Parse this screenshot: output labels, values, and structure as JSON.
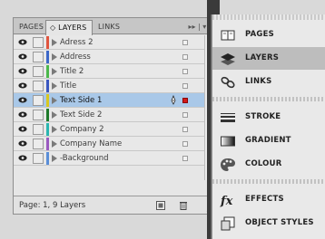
{
  "layers_panel": {
    "tabs": [
      {
        "label": "PAGES"
      },
      {
        "label": "◇ LAYERS"
      },
      {
        "label": "LINKS"
      }
    ],
    "controls_label": "▸▸ | ▾≡",
    "layers": [
      {
        "name": "Adress 2",
        "color": "#e0553f",
        "selected": false
      },
      {
        "name": "Address",
        "color": "#3c67c8",
        "selected": false
      },
      {
        "name": "Title 2",
        "color": "#4bb84b",
        "selected": false
      },
      {
        "name": "Title",
        "color": "#3a57c0",
        "selected": false
      },
      {
        "name": "Text Side 1",
        "color": "#d8c820",
        "selected": true
      },
      {
        "name": "Text Side 2",
        "color": "#1f7a2b",
        "selected": false
      },
      {
        "name": "Company 2",
        "color": "#2bb6b0",
        "selected": false
      },
      {
        "name": "Company Name",
        "color": "#9a5ac0",
        "selected": false
      },
      {
        "name": "-Background",
        "color": "#5a8ed8",
        "selected": false
      }
    ],
    "footer": {
      "status": "Page: 1, 9 Layers"
    }
  },
  "dock_menu": {
    "items": [
      {
        "label": "PAGES",
        "icon": "pages-icon",
        "active": false
      },
      {
        "label": "LAYERS",
        "icon": "layers-icon",
        "active": true
      },
      {
        "label": "LINKS",
        "icon": "links-icon",
        "active": false
      },
      {
        "label": "STROKE",
        "icon": "stroke-icon",
        "active": false
      },
      {
        "label": "GRADIENT",
        "icon": "gradient-icon",
        "active": false
      },
      {
        "label": "COLOUR",
        "icon": "colour-icon",
        "active": false
      },
      {
        "label": "EFFECTS",
        "icon": "effects-icon",
        "active": false
      },
      {
        "label": "OBJECT STYLES",
        "icon": "object-styles-icon",
        "active": false
      }
    ]
  }
}
